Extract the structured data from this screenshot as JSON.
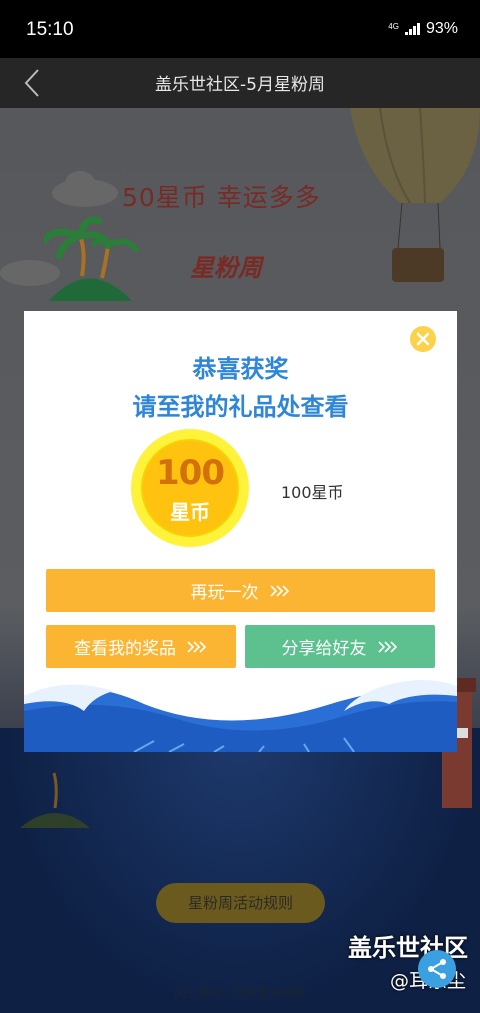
{
  "status_bar": {
    "time": "15:10",
    "network": "4G",
    "battery": "93%"
  },
  "header": {
    "title": "盖乐世社区-5月星粉周"
  },
  "background": {
    "headline": "50星币   幸运多多",
    "logo": "星粉周",
    "rules_button": "星粉周活动规则",
    "scroll_hint": "向上滑动，尽享更多精彩"
  },
  "watermark": {
    "title": "盖乐世社区",
    "user": "@耳东尘"
  },
  "dialog": {
    "title_line1": "恭喜获奖",
    "title_line2": "请至我的礼品处查看",
    "coin": {
      "amount": "100",
      "unit": "星币"
    },
    "prize_label": "100星币",
    "play_again": "再玩一次",
    "view_prizes": "查看我的奖品",
    "share_friends": "分享给好友"
  },
  "colors": {
    "title_blue": "#2f86d8",
    "orange_button": "#fbb532",
    "green_button": "#5cc08f",
    "coin_yellow": "#ffc20e"
  },
  "icons": {
    "back": "chevron-left-icon",
    "close": "close-icon",
    "share": "share-icon"
  }
}
